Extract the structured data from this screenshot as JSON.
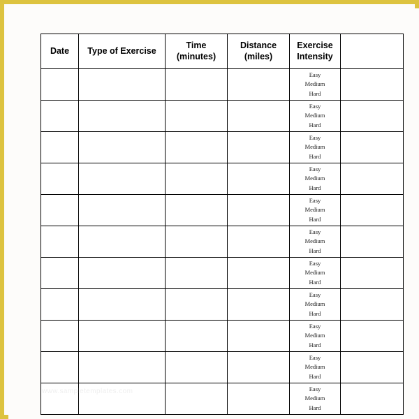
{
  "page": {
    "background_color": "#fdfcfa",
    "frame_color": "#ddc33f",
    "watermark_text": "www.sampletemplates.com"
  },
  "table": {
    "columns": [
      {
        "key": "date",
        "label_line1": "Date",
        "label_line2": ""
      },
      {
        "key": "type",
        "label_line1": "Type of Exercise",
        "label_line2": ""
      },
      {
        "key": "time",
        "label_line1": "Time",
        "label_line2": "(minutes)"
      },
      {
        "key": "distance",
        "label_line1": "Distance",
        "label_line2": "(miles)"
      },
      {
        "key": "intensity",
        "label_line1": "Exercise",
        "label_line2": "Intensity"
      },
      {
        "key": "blank",
        "label_line1": "",
        "label_line2": ""
      }
    ],
    "intensity_options": [
      "Easy",
      "Medium",
      "Hard"
    ],
    "row_count": 11,
    "rows": [
      {
        "date": "",
        "type": "",
        "time": "",
        "distance": "",
        "blank": ""
      },
      {
        "date": "",
        "type": "",
        "time": "",
        "distance": "",
        "blank": ""
      },
      {
        "date": "",
        "type": "",
        "time": "",
        "distance": "",
        "blank": ""
      },
      {
        "date": "",
        "type": "",
        "time": "",
        "distance": "",
        "blank": ""
      },
      {
        "date": "",
        "type": "",
        "time": "",
        "distance": "",
        "blank": ""
      },
      {
        "date": "",
        "type": "",
        "time": "",
        "distance": "",
        "blank": ""
      },
      {
        "date": "",
        "type": "",
        "time": "",
        "distance": "",
        "blank": ""
      },
      {
        "date": "",
        "type": "",
        "time": "",
        "distance": "",
        "blank": ""
      },
      {
        "date": "",
        "type": "",
        "time": "",
        "distance": "",
        "blank": ""
      },
      {
        "date": "",
        "type": "",
        "time": "",
        "distance": "",
        "blank": ""
      },
      {
        "date": "",
        "type": "",
        "time": "",
        "distance": "",
        "blank": ""
      }
    ]
  }
}
